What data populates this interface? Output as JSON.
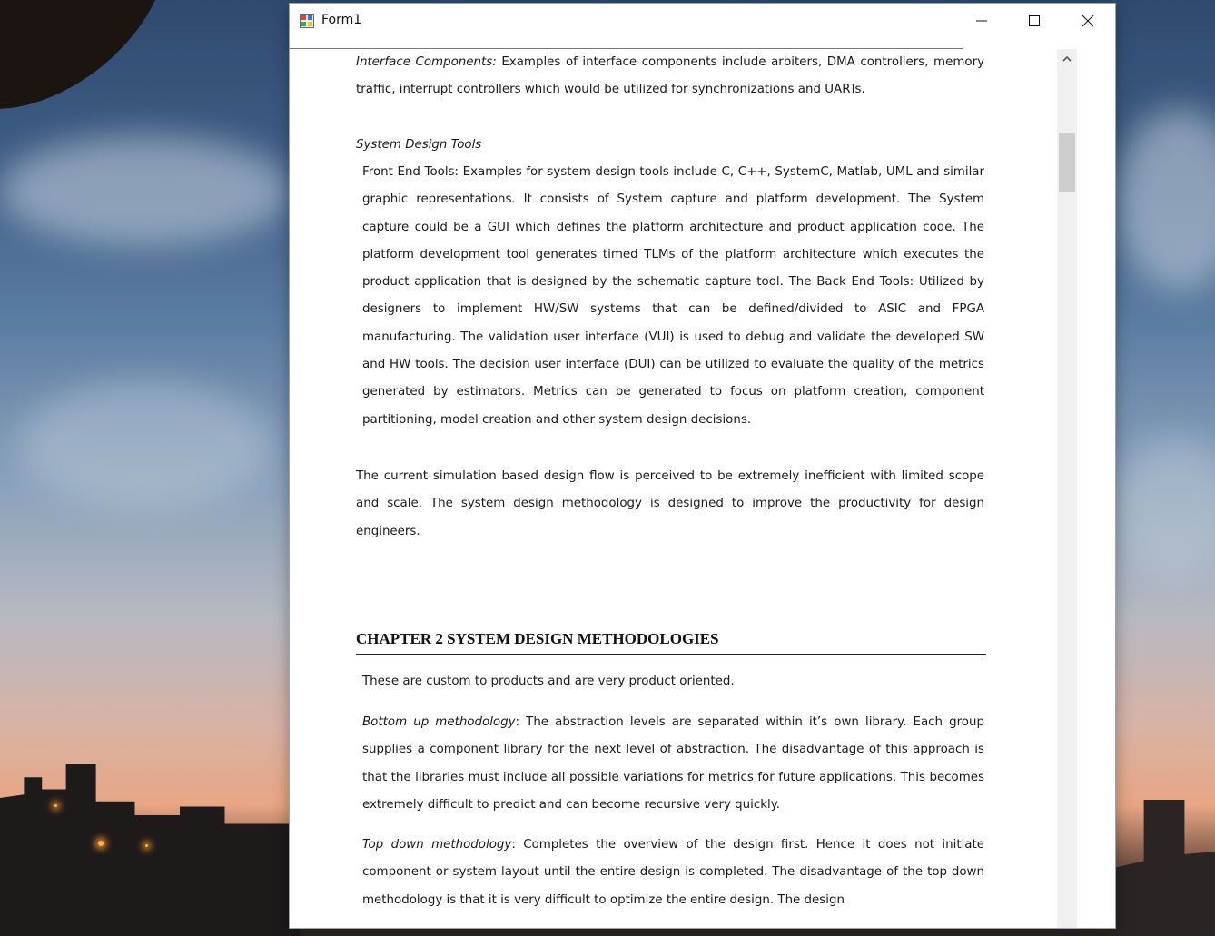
{
  "window": {
    "title": "Form1"
  },
  "controls": {
    "minimize": "minimize",
    "maximize": "maximize",
    "close": "close"
  },
  "document": {
    "p1_lead": "Interface Components:",
    "p1_text": " Examples of interface components include arbiters, DMA controllers, memory traffic, interrupt controllers which would be utilized for synchronizations and UARTs.",
    "sdt_heading": "System Design Tools",
    "p2_text": "Front End Tools: Examples for system design tools include C, C++, SystemC, Matlab, UML and similar graphic representations. It consists of System capture and platform development.  The System capture could be a GUI which defines the platform architecture and product application code. The platform development tool generates timed TLMs of the platform architecture which executes the product application that is designed by the schematic capture tool.  The Back End Tools:  Utilized by designers to implement HW/SW systems that can be defined/divided to ASIC and FPGA manufacturing.   The validation user interface (VUI) is used to debug and validate the developed SW and HW tools.  The decision user interface (DUI) can be utilized to evaluate the quality of the metrics generated by estimators.  Metrics can be generated to focus on platform creation, component partitioning, model creation and other system design decisions.",
    "p3_text": "The current simulation based design flow is perceived to be extremely inefficient with limited scope and scale.  The system design methodology is designed to improve the productivity for design engineers.",
    "chapter_title": "CHAPTER 2 SYSTEM DESIGN METHODOLOGIES",
    "p4_text": "These are custom to products and are very product oriented.",
    "p5_lead": "Bottom up methodology",
    "p5_text": ":  The abstraction levels are separated within it’s own library.  Each group supplies a component library for the next level of abstraction.  The disadvantage of this approach is that the libraries must include all possible variations for metrics for future applications.  This becomes extremely difficult to predict and can become recursive very quickly.",
    "p6_lead": "Top down methodology",
    "p6_text": ":   Completes the overview of the design first. Hence it does not initiate component or system layout until the entire design is completed.  The disadvantage of the top-down methodology is that it is very difficult to optimize the entire design.   The design"
  },
  "scrollbar": {
    "position": 0.12
  }
}
